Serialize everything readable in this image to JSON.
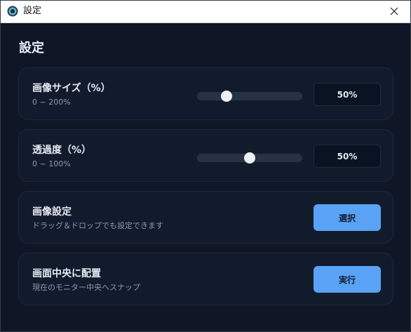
{
  "window": {
    "title": "設定",
    "icon": "app-logo-icon",
    "close_icon": "close-icon"
  },
  "page": {
    "title": "設定"
  },
  "image_size": {
    "label": "画像サイズ（%）",
    "range": "0 ~ 200%",
    "value_text": "50%",
    "value": 50,
    "min": 0,
    "max": 200
  },
  "opacity": {
    "label": "透過度（%）",
    "range": "0 ~ 100%",
    "value_text": "50%",
    "value": 50,
    "min": 0,
    "max": 100
  },
  "image_setting": {
    "label": "画像設定",
    "description": "ドラッグ＆ドロップでも設定できます",
    "button_label": "選択"
  },
  "center_placement": {
    "label": "画面中央に配置",
    "description": "現在のモニター中央へスナップ",
    "button_label": "実行"
  },
  "colors": {
    "background": "#0f1727",
    "card": "#111b2c",
    "accent": "#5aa2f5",
    "titlebar": "#ffffff"
  }
}
